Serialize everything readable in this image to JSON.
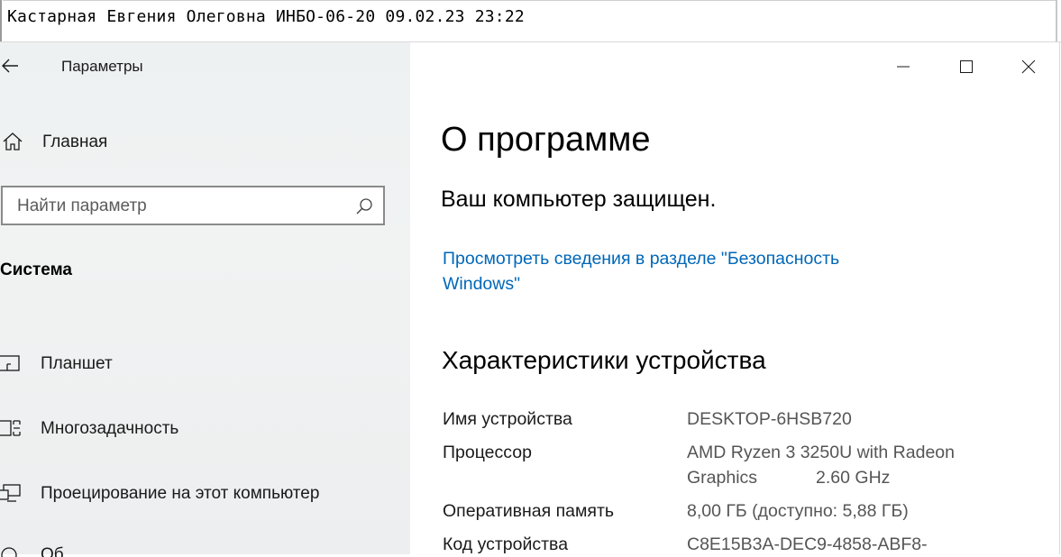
{
  "caption": "Кастарная Евгения Олеговна ИНБО-06-20 09.02.23 23:22",
  "window": {
    "title": "Параметры",
    "controls": {
      "minimize": "minimize",
      "maximize": "maximize",
      "close": "close"
    }
  },
  "sidebar": {
    "home_label": "Главная",
    "search_placeholder": "Найти параметр",
    "section": "Система",
    "items": [
      {
        "label": "Планшет",
        "icon": "tablet-icon"
      },
      {
        "label": "Многозадачность",
        "icon": "multitasking-icon"
      },
      {
        "label": "Проецирование на этот компьютер",
        "icon": "projecting-icon"
      },
      {
        "label": "Об",
        "icon": "info-icon"
      }
    ]
  },
  "main": {
    "title": "О программе",
    "secured": "Ваш компьютер защищен.",
    "security_link": "Просмотреть сведения в разделе \"Безопасность Windows\"",
    "spec_title": "Характеристики устройства",
    "specs": [
      {
        "key": "Имя устройства",
        "value": "DESKTOP-6HSB720"
      },
      {
        "key": "Процессор",
        "value": "AMD Ryzen 3 3250U with Radeon Graphics            2.60 GHz"
      },
      {
        "key": "Оперативная память",
        "value": "8,00 ГБ (доступно: 5,88 ГБ)"
      },
      {
        "key": "Код устройства",
        "value": "C8E15B3A-DEC9-4858-ABF8-"
      }
    ]
  },
  "colors": {
    "link": "#0067b8",
    "sidebar_bg": "#eef1f2"
  }
}
